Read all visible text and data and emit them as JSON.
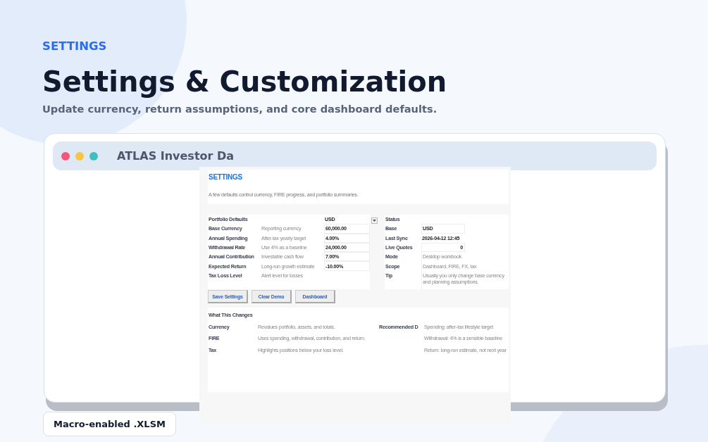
{
  "hero": {
    "eyebrow": "SETTINGS",
    "title": "Settings & Customization",
    "subtitle": "Update currency, return assumptions, and core dashboard defaults."
  },
  "window": {
    "title": "ATLAS Investor Da"
  },
  "sheet": {
    "heading": "SETTINGS",
    "description": "A few defaults control currency, FIRE progress, and portfolio summaries.",
    "defaults": {
      "title": "Portfolio Defaults",
      "header_value": "USD",
      "rows": [
        {
          "label": "Base Currency",
          "hint": "Reporting currency",
          "value": "60,000.00"
        },
        {
          "label": "Annual Spending",
          "hint": "After-tax yearly target",
          "value": "4.00%"
        },
        {
          "label": "Withdrawal Rate",
          "hint": "Use 4% as a baseline",
          "value": "24,000.00"
        },
        {
          "label": "Annual Contribution",
          "hint": "Investable cash flow",
          "value": "7.00%"
        },
        {
          "label": "Expected Return",
          "hint": "Long-run growth estimate",
          "value": "-10.00%"
        },
        {
          "label": "Tax Loss Level",
          "hint": "Alert level for losses"
        }
      ]
    },
    "status": {
      "title": "Status",
      "rows": [
        {
          "label": "Base",
          "value": "USD",
          "kind": "field"
        },
        {
          "label": "Last Sync",
          "value": "2026-04-12 12:45",
          "kind": "bold"
        },
        {
          "label": "Live Quotes",
          "value": "0",
          "kind": "number"
        },
        {
          "label": "Mode",
          "value": "Desktop workbook",
          "kind": "text"
        },
        {
          "label": "Scope",
          "value": "Dashboard, FIRE, FX, tax",
          "kind": "text"
        },
        {
          "label": "Tip",
          "value": "Usually you only change base currency and planning assumptions.",
          "kind": "text"
        }
      ]
    },
    "buttons": [
      "Save Settings",
      "Clear Demo",
      "Dashboard"
    ],
    "changes": {
      "title": "What This Changes",
      "rows": [
        {
          "label": "Currency",
          "text": "Revalues portfolio, assets, and totals.",
          "side_label": "Recommended D",
          "side_text": "Spending: after-tax lifestyle target"
        },
        {
          "label": "FIRE",
          "text": "Uses spending, withdrawal, contribution, and return.",
          "side_text": "Withdrawal: 4% is a sensible baseline"
        },
        {
          "label": "Tax",
          "text": "Highlights positions below your loss level.",
          "side_text": "Return: long-run estimate, not next year"
        }
      ]
    }
  },
  "badge": "Macro-enabled .XLSM"
}
